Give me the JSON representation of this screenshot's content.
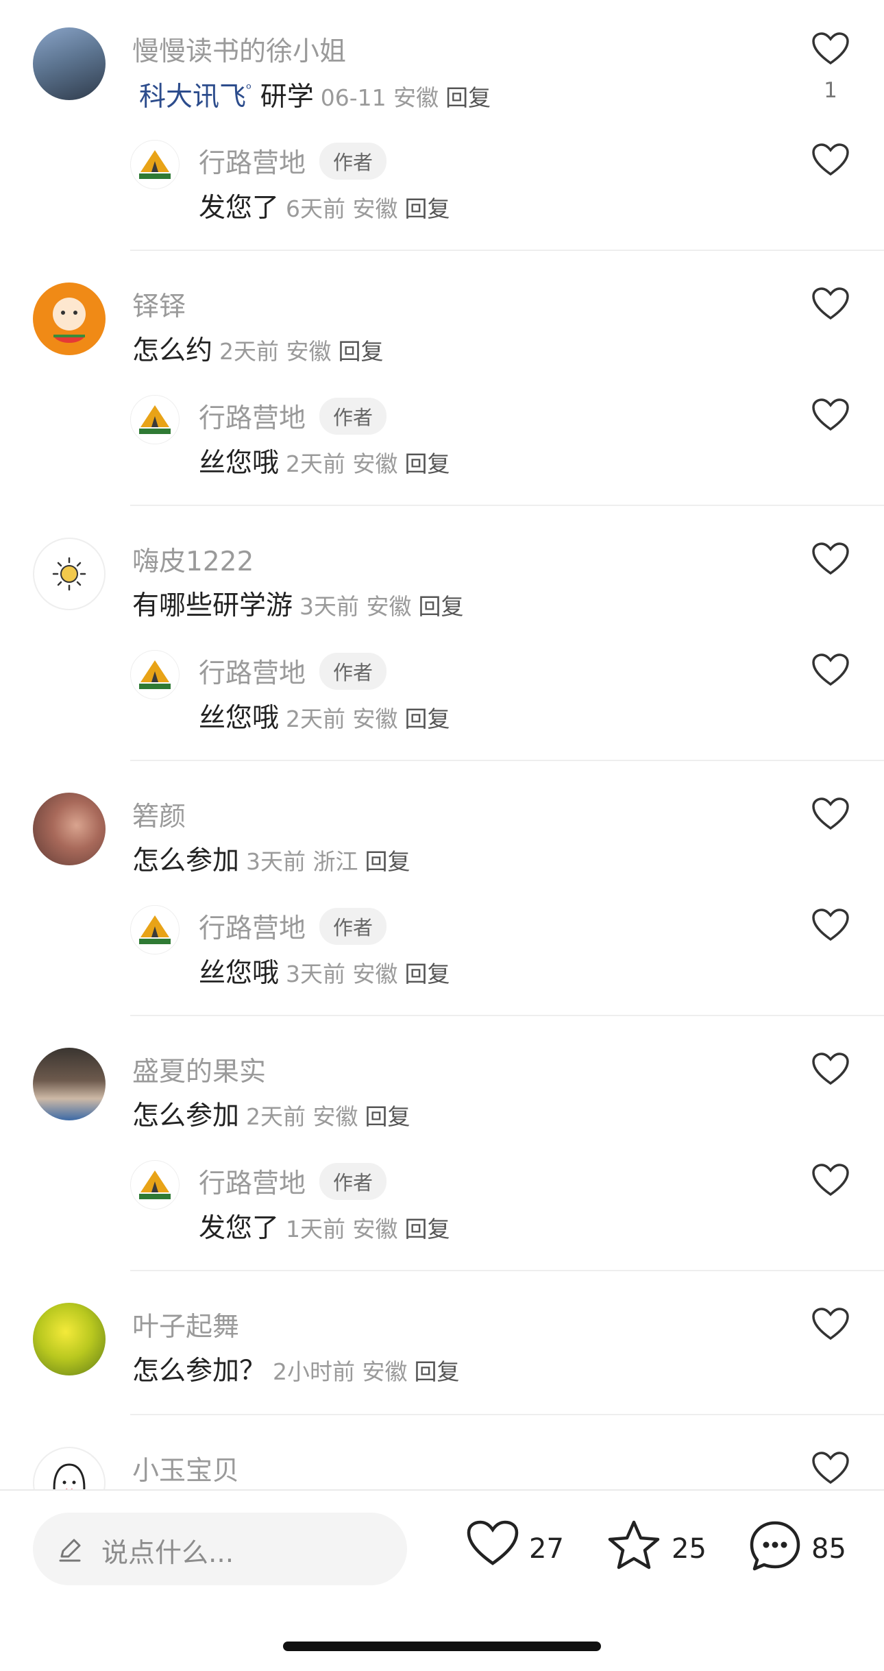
{
  "comments": [
    {
      "user": "慢慢读书的徐小姐",
      "text": "科大讯飞",
      "search_tag": "研学",
      "time": "06-11",
      "location": "安徽",
      "reply_label": "回复",
      "likes": "1",
      "author_reply": {
        "user": "行路营地",
        "badge": "作者",
        "text": "发您了",
        "time": "6天前",
        "location": "安徽",
        "reply_label": "回复"
      }
    },
    {
      "user": "铎铎",
      "text": "怎么约",
      "time": "2天前",
      "location": "安徽",
      "reply_label": "回复",
      "author_reply": {
        "user": "行路营地",
        "badge": "作者",
        "text": "丝您哦",
        "time": "2天前",
        "location": "安徽",
        "reply_label": "回复"
      }
    },
    {
      "user": "嗨皮1222",
      "text": "有哪些研学游",
      "time": "3天前",
      "location": "安徽",
      "reply_label": "回复",
      "author_reply": {
        "user": "行路营地",
        "badge": "作者",
        "text": "丝您哦",
        "time": "2天前",
        "location": "安徽",
        "reply_label": "回复"
      }
    },
    {
      "user": "箬颜",
      "text": "怎么参加",
      "time": "3天前",
      "location": "浙江",
      "reply_label": "回复",
      "author_reply": {
        "user": "行路营地",
        "badge": "作者",
        "text": "丝您哦",
        "time": "3天前",
        "location": "安徽",
        "reply_label": "回复"
      }
    },
    {
      "user": "盛夏的果实",
      "text": "怎么参加",
      "time": "2天前",
      "location": "安徽",
      "reply_label": "回复",
      "author_reply": {
        "user": "行路营地",
        "badge": "作者",
        "text": "发您了",
        "time": "1天前",
        "location": "安徽",
        "reply_label": "回复"
      }
    },
    {
      "user": "叶子起舞",
      "text": "怎么参加？",
      "time": "2小时前",
      "location": "安徽",
      "reply_label": "回复"
    },
    {
      "user": "小玉宝贝"
    }
  ],
  "bottom_bar": {
    "input_placeholder": "说点什么...",
    "likes": "27",
    "favorites": "25",
    "comments": "85"
  },
  "icons": {
    "like": "heart-outline-icon",
    "favorite": "star-outline-icon",
    "comment": "chat-bubble-icon",
    "edit": "pencil-icon"
  },
  "colors": {
    "username": "#9a9a9a",
    "link": "#2c4c8c",
    "divider": "#eeeeee"
  }
}
